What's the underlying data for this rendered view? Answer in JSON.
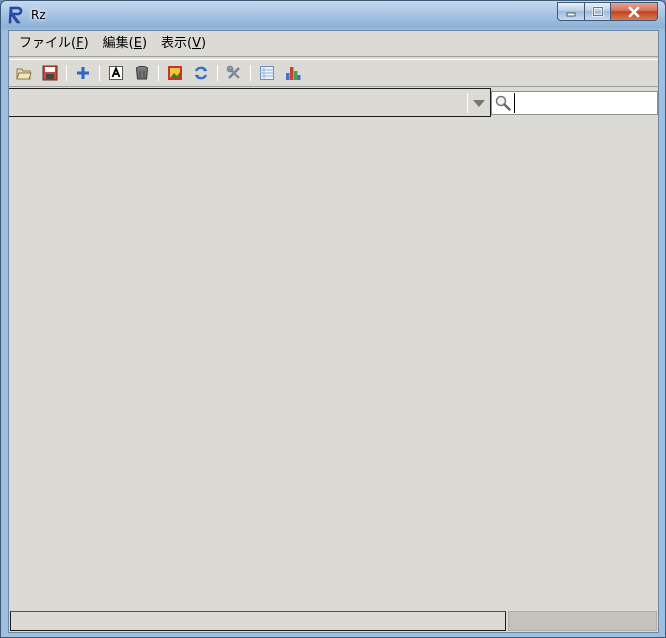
{
  "window": {
    "title": "Rz"
  },
  "menubar": {
    "items": [
      {
        "label": "ファイル(",
        "mnemonic": "F",
        "suffix": ")"
      },
      {
        "label": "編集(",
        "mnemonic": "E",
        "suffix": ")"
      },
      {
        "label": "表示(",
        "mnemonic": "V",
        "suffix": ")"
      }
    ]
  },
  "toolbar": {
    "icons": [
      "folder-open-icon",
      "save-icon",
      "add-icon",
      "text-icon",
      "trash-icon",
      "image-icon",
      "refresh-icon",
      "tools-icon",
      "table-icon",
      "chart-icon"
    ]
  },
  "filter": {
    "selected": ""
  },
  "search": {
    "value": "",
    "placeholder": ""
  },
  "status": {
    "main_text": "",
    "right_text": ""
  },
  "colors": {
    "titlebar": "#9fbfdf",
    "client": "#dcdad5",
    "close": "#c2421f"
  }
}
